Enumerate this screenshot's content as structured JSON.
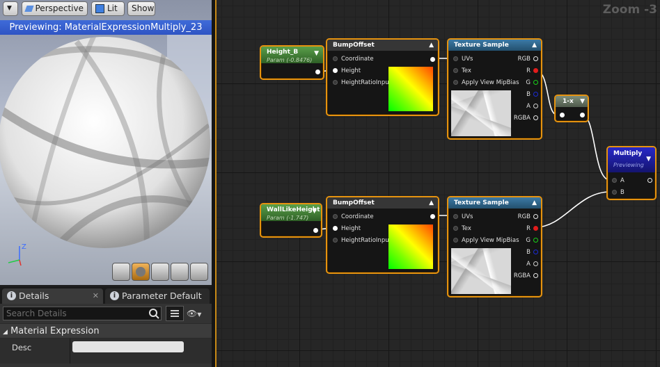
{
  "viewport": {
    "menu_label": "▼",
    "perspective_label": "Perspective",
    "lit_label": "Lit",
    "show_label": "Show",
    "preview_text": "Previewing: MaterialExpressionMultiply_23",
    "axis_z": "Z"
  },
  "details": {
    "tab_details": "Details",
    "tab_params": "Parameter Default",
    "search_placeholder": "Search Details",
    "section_title": "Material Expression",
    "desc_label": "Desc",
    "desc_value": ""
  },
  "graph": {
    "zoom_text": "Zoom -3",
    "nodes": {
      "height_b": {
        "title": "Height_B",
        "subtitle": "Param (-0.8476)"
      },
      "walllike": {
        "title": "WallLikeHeight",
        "subtitle": "Param (-1.747)"
      },
      "bump1": {
        "title": "BumpOffset",
        "pins": [
          "Coordinate",
          "Height",
          "HeightRatioInput"
        ]
      },
      "bump2": {
        "title": "BumpOffset",
        "pins": [
          "Coordinate",
          "Height",
          "HeightRatioInput"
        ]
      },
      "tex1": {
        "title": "Texture Sample",
        "inputs": [
          "UVs",
          "Tex",
          "Apply View MipBias"
        ],
        "outputs": [
          "RGB",
          "R",
          "G",
          "B",
          "A",
          "RGBA"
        ]
      },
      "tex2": {
        "title": "Texture Sample",
        "inputs": [
          "UVs",
          "Tex",
          "Apply View MipBias"
        ],
        "outputs": [
          "RGB",
          "R",
          "G",
          "B",
          "A",
          "RGBA"
        ]
      },
      "oneminus": {
        "title": "1-x"
      },
      "multiply": {
        "title": "Multiply",
        "subtitle": "Previewing",
        "pins": [
          "A",
          "B"
        ]
      }
    }
  },
  "colors": {
    "selection_border": "#e6930f",
    "param_header": "#4c8a3c",
    "function_header": "#2e5f83",
    "multiply_header": "#1d1d9a",
    "preview_bar": "#3058c8"
  }
}
